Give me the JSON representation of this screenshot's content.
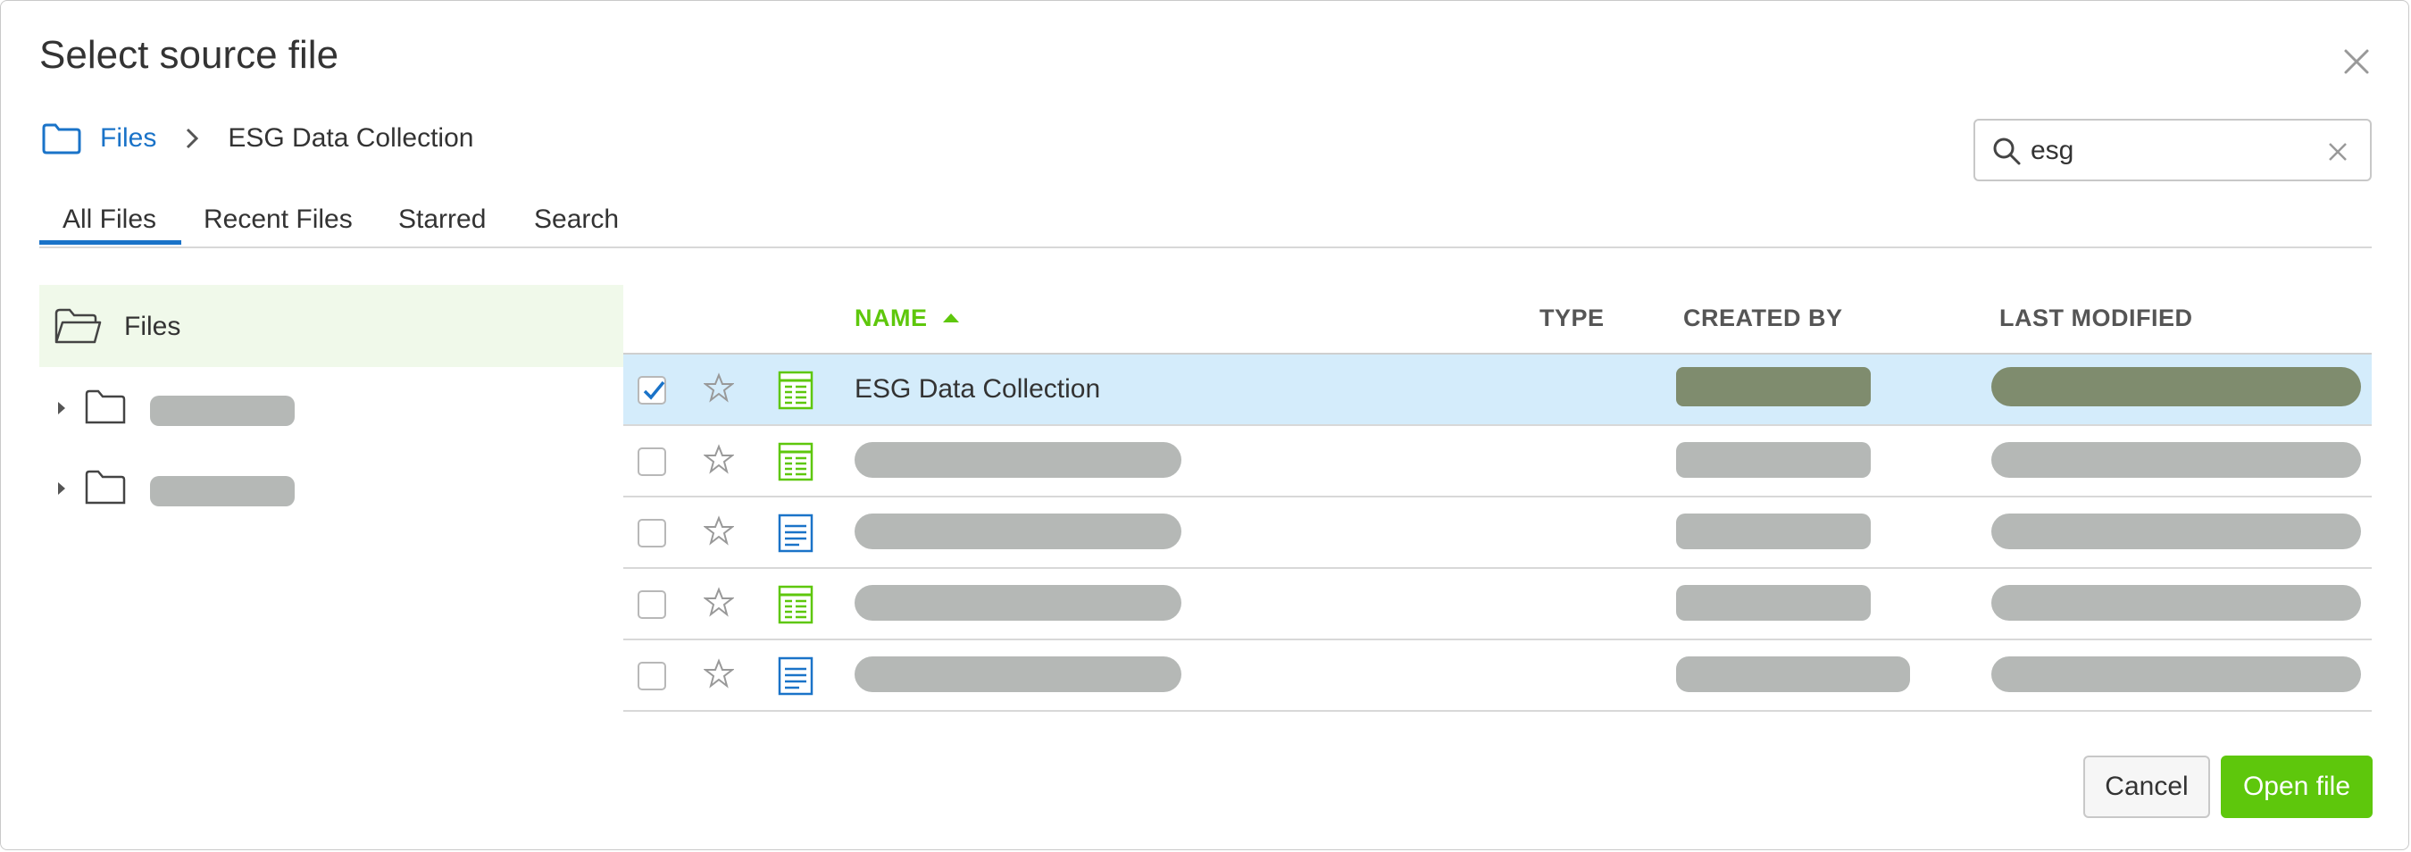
{
  "dialog": {
    "title": "Select source file"
  },
  "breadcrumb": {
    "root_label": "Files",
    "current_label": "ESG Data Collection"
  },
  "search": {
    "value": "esg"
  },
  "tabs": [
    {
      "label": "All Files",
      "active": true
    },
    {
      "label": "Recent Files",
      "active": false
    },
    {
      "label": "Starred",
      "active": false
    },
    {
      "label": "Search",
      "active": false
    }
  ],
  "tree": {
    "root_label": "Files",
    "items": [
      {
        "label": "",
        "redacted": true
      },
      {
        "label": "",
        "redacted": true
      }
    ]
  },
  "table": {
    "columns": [
      {
        "label": "NAME",
        "sorted": "ascending"
      },
      {
        "label": "TYPE"
      },
      {
        "label": "CREATED BY"
      },
      {
        "label": "LAST MODIFIED"
      }
    ],
    "rows": [
      {
        "name": "ESG Data Collection",
        "file_type": "sheet",
        "selected": true,
        "checked": true,
        "starred": false
      },
      {
        "name": "",
        "file_type": "sheet",
        "selected": false,
        "checked": false,
        "starred": false,
        "redacted": true
      },
      {
        "name": "",
        "file_type": "document",
        "selected": false,
        "checked": false,
        "starred": false,
        "redacted": true
      },
      {
        "name": "",
        "file_type": "sheet",
        "selected": false,
        "checked": false,
        "starred": false,
        "redacted": true
      },
      {
        "name": "",
        "file_type": "document",
        "selected": false,
        "checked": false,
        "starred": false,
        "redacted": true
      }
    ]
  },
  "buttons": {
    "cancel_label": "Cancel",
    "open_label": "Open file"
  },
  "colors": {
    "accent_green": "#5ec70c",
    "link_blue": "#1a73c8",
    "selected_row": "#d4ecfb",
    "tree_selected": "#f0f9ea",
    "redaction_gray": "#b5b8b6",
    "redaction_dark": "#7f8c6e"
  },
  "icons": {
    "close": "close-icon",
    "folder": "folder-icon",
    "search": "search-icon",
    "clear": "clear-search-icon",
    "star": "star-icon",
    "sheet": "spreadsheet-icon",
    "document": "document-icon"
  }
}
